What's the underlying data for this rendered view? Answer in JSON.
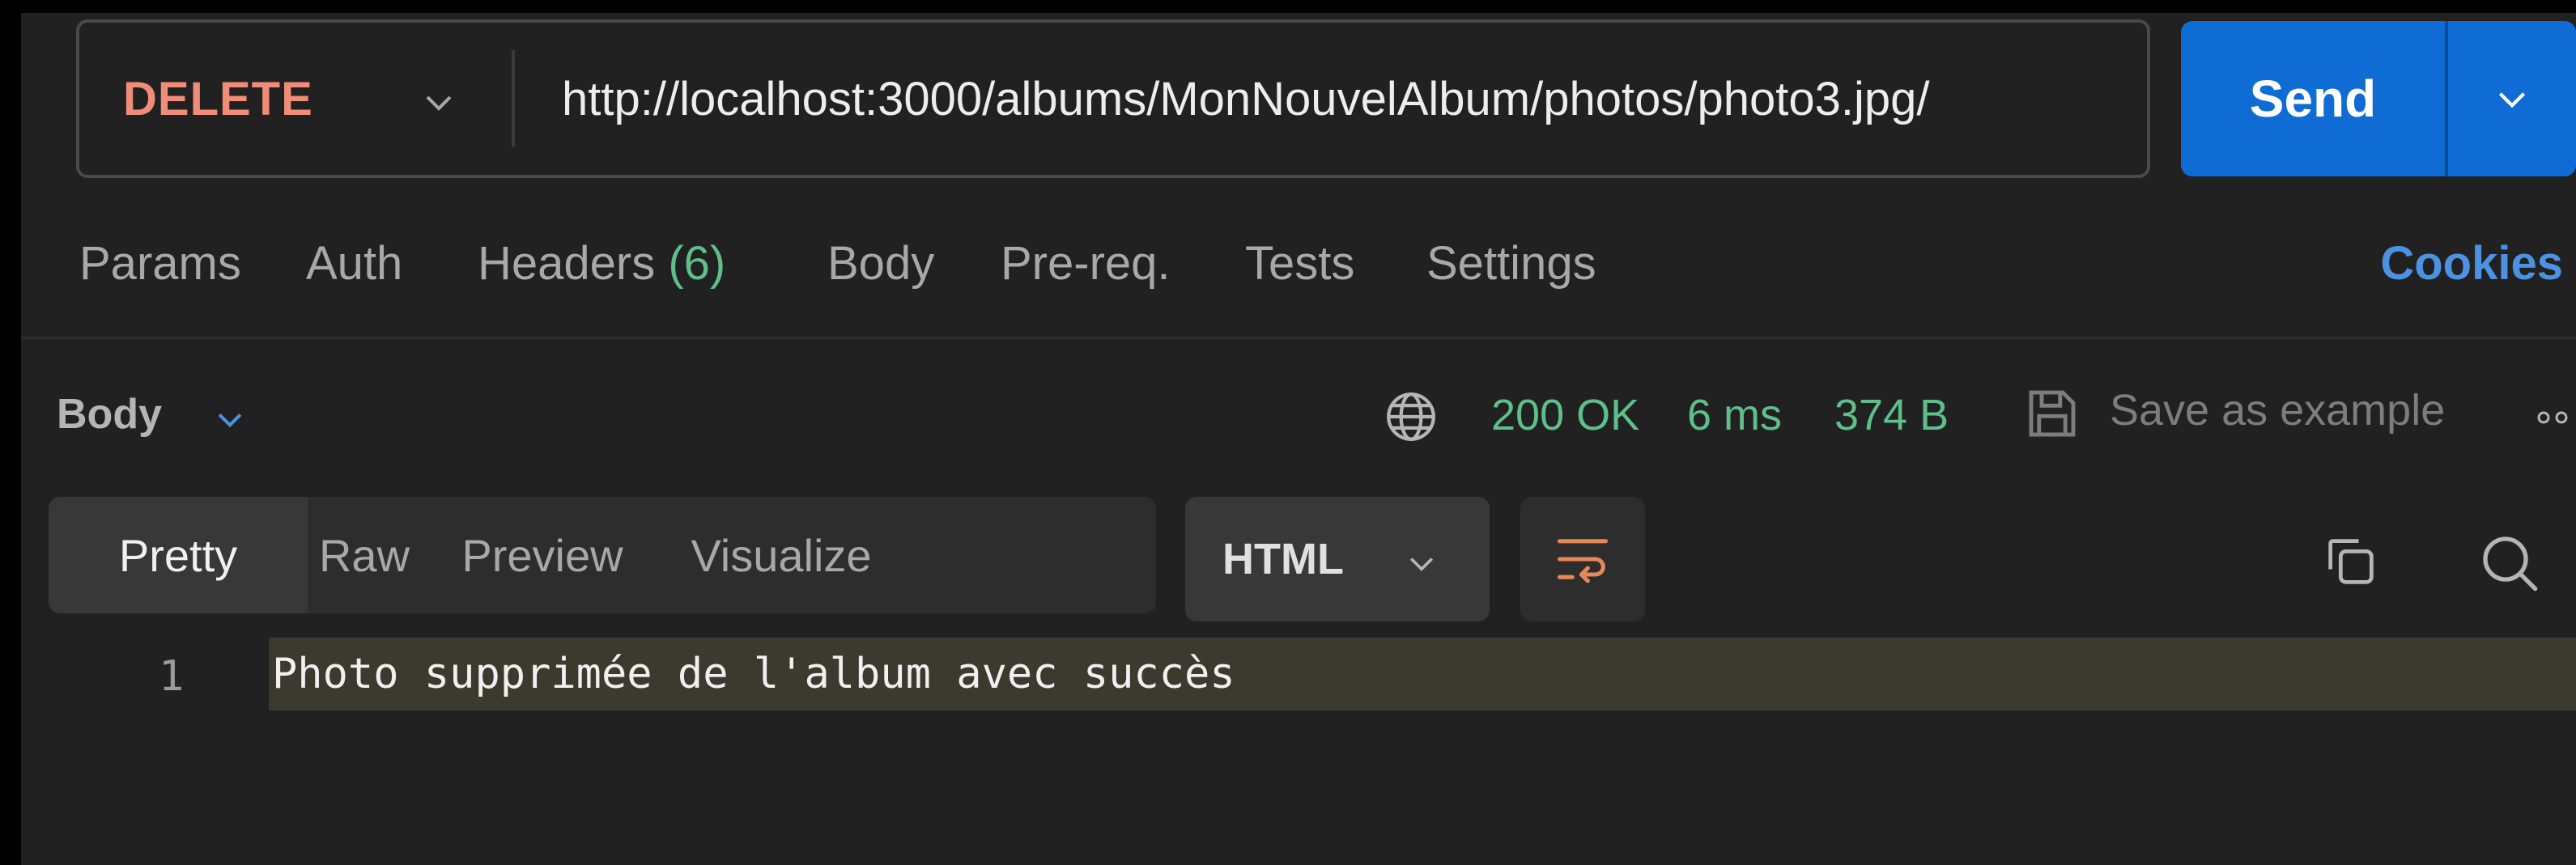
{
  "request": {
    "method": "DELETE",
    "url": "http://localhost:3000/albums/MonNouvelAlbum/photos/photo3.jpg/",
    "send_label": "Send"
  },
  "request_tabs": {
    "params": "Params",
    "auth": "Auth",
    "headers": "Headers",
    "headers_count": "(6)",
    "body": "Body",
    "prereq": "Pre-req.",
    "tests": "Tests",
    "settings": "Settings",
    "cookies": "Cookies"
  },
  "response": {
    "section_label": "Body",
    "status": "200 OK",
    "time": "6 ms",
    "size": "374 B",
    "save_label": "Save as example",
    "view_tabs": [
      "Pretty",
      "Raw",
      "Preview",
      "Visualize"
    ],
    "active_view": "Pretty",
    "language": "HTML",
    "lines": [
      {
        "number": "1",
        "text": "Photo supprimée de l'album avec succès"
      }
    ]
  },
  "colors": {
    "method_delete": "#f08d78",
    "send_button": "#0f6cd4",
    "status_ok": "#5fbf8a",
    "cookies_link": "#4c92e3",
    "wrap_icon": "#e8875a",
    "line_highlight": "#3a3a2f"
  },
  "icons": {
    "method_dropdown": "chevron-down-icon",
    "send_dropdown": "chevron-down-icon",
    "network": "globe-icon",
    "save": "save-icon",
    "more": "more-icon",
    "wrap": "word-wrap-icon",
    "copy": "copy-icon",
    "search": "search-icon"
  }
}
